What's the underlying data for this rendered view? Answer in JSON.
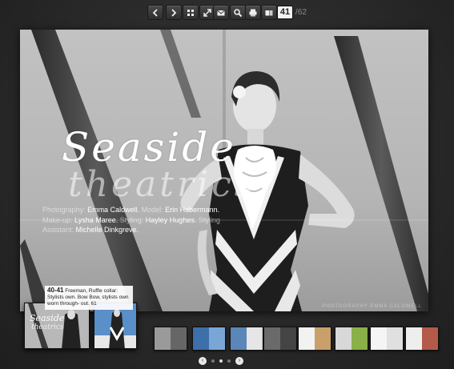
{
  "toolbar": {
    "buttons": [
      {
        "name": "previous-page-button",
        "icon": "chevron-left-icon"
      },
      {
        "name": "next-page-button",
        "icon": "chevron-right-icon"
      },
      {
        "name": "thumbnails-button",
        "icon": "grid-icon"
      },
      {
        "name": "fullscreen-button",
        "icon": "expand-icon"
      },
      {
        "name": "email-button",
        "icon": "envelope-icon"
      },
      {
        "name": "zoom-button",
        "icon": "magnifier-icon"
      },
      {
        "name": "print-button",
        "icon": "printer-icon"
      },
      {
        "name": "pages-view-button",
        "icon": "pages-icon"
      }
    ],
    "current_page": "41",
    "total_pages": "/62"
  },
  "spread": {
    "title_line1": "Seaside",
    "title_line2": "theatrics",
    "credits": [
      {
        "label": "Photography:",
        "value": "Emma Caldwell.",
        "label2": "Model:",
        "value2": "Erin Habermann."
      },
      {
        "label": "Make-up:",
        "value": "Lysha Maree.",
        "label2": "Styling:",
        "value2": "Hayley Hughes.",
        "label3": "Styling"
      },
      {
        "label": "Assistant:",
        "value": "Michelle Dinkgreve."
      }
    ],
    "corner_text": "PHOTOGRAPHY EMMA CALDWELL"
  },
  "thumbnail_caption": {
    "page_ref": "40-41",
    "text": "Freeman, Ruffle collar: Stylists own. Bow Bow, stylists own worn through- out. 61"
  },
  "pager": {
    "prev": "‹",
    "next": "›",
    "dots": 3,
    "active_dot": 1
  },
  "colors": {
    "background": "#2a2a2a",
    "toolbar_button": "#3a3a3a",
    "accent_blue": "#4a8fd0"
  }
}
